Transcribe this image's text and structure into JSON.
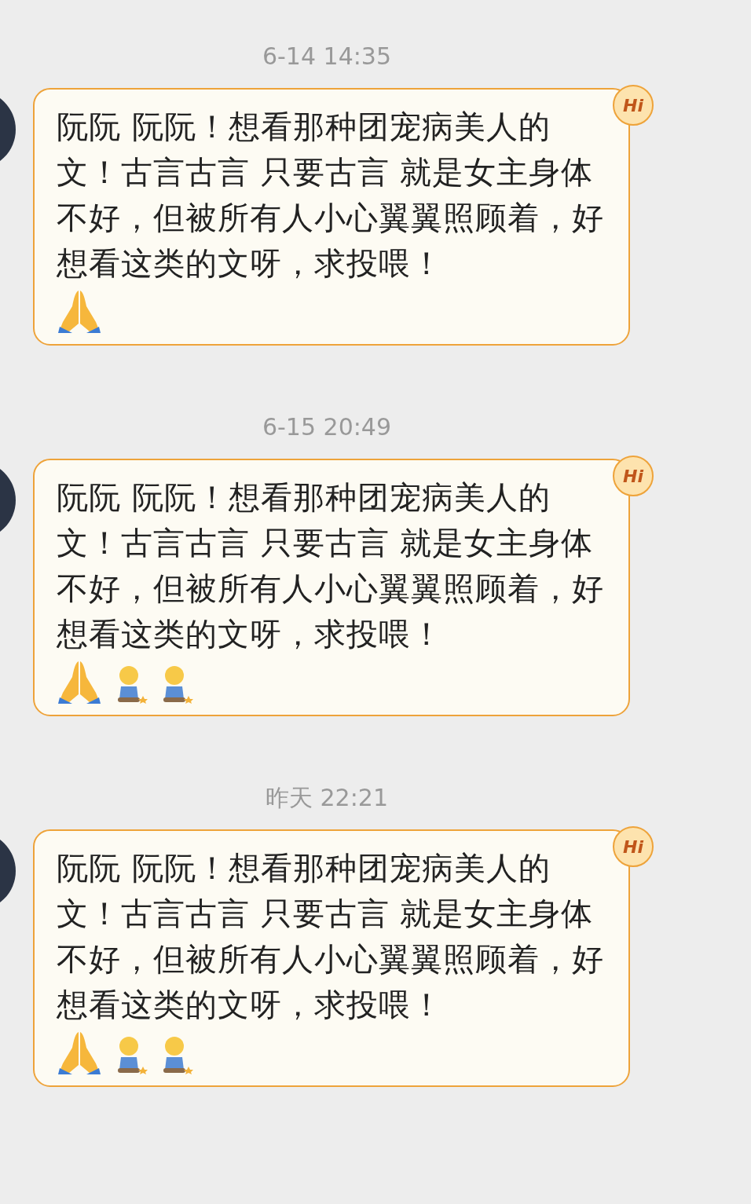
{
  "messages": [
    {
      "time": "6-14 14:35",
      "badge": "Hi",
      "text": "阮阮 阮阮！想看那种团宠病美人的文！古言古言 只要古言 就是女主身体不好，但被所有人小心翼翼照顾着，好想看这类的文呀，求投喂！",
      "emojis": [
        {
          "kind": "pray"
        }
      ]
    },
    {
      "time": "6-15 20:49",
      "badge": "Hi",
      "text": "阮阮 阮阮！想看那种团宠病美人的文！古言古言 只要古言 就是女主身体不好，但被所有人小心翼翼照顾着，好想看这类的文呀，求投喂！",
      "emojis": [
        {
          "kind": "pray"
        },
        {
          "kind": "kneel"
        },
        {
          "kind": "kneel"
        }
      ]
    },
    {
      "time": "昨天 22:21",
      "badge": "Hi",
      "text": "阮阮 阮阮！想看那种团宠病美人的文！古言古言 只要古言 就是女主身体不好，但被所有人小心翼翼照顾着，好想看这类的文呀，求投喂！",
      "emojis": [
        {
          "kind": "pray"
        },
        {
          "kind": "kneel"
        },
        {
          "kind": "kneel"
        }
      ]
    }
  ]
}
